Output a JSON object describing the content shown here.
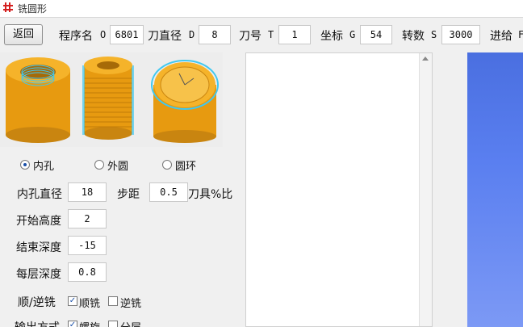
{
  "window": {
    "title": "铣圆形"
  },
  "toolbar": {
    "back_label": "返回",
    "program_label": "程序名",
    "program_prefix": "O",
    "program_value": "6801",
    "diameter_label": "刀直径",
    "diameter_prefix": "D",
    "diameter_value": "8",
    "tool_label": "刀号",
    "tool_prefix": "T",
    "tool_value": "1",
    "coord_label": "坐标",
    "coord_prefix": "G",
    "coord_value": "54",
    "speed_label": "转数",
    "speed_prefix": "S",
    "speed_value": "3000",
    "feed_label": "进给",
    "feed_prefix": "F"
  },
  "modes": [
    {
      "label": "内孔",
      "selected": true
    },
    {
      "label": "外圆",
      "selected": false
    },
    {
      "label": "圆环",
      "selected": false
    }
  ],
  "params": {
    "inner_dia_label": "内孔直径",
    "inner_dia_value": "18",
    "step_label": "步距",
    "step_value": "0.5",
    "tool_pct_label": "刀具%比",
    "start_height_label": "开始高度",
    "start_height_value": "2",
    "end_depth_label": "结束深度",
    "end_depth_value": "-15",
    "layer_depth_label": "每层深度",
    "layer_depth_value": "0.8"
  },
  "milling": {
    "label": "顺/逆铣",
    "climb_label": "顺铣",
    "climb_checked": true,
    "conventional_label": "逆铣",
    "conventional_checked": false
  },
  "output": {
    "label": "输出方式",
    "spiral_label": "螺旋",
    "spiral_checked": true,
    "layered_label": "分层",
    "layered_checked": false
  },
  "colors": {
    "part": "#f0a818",
    "part_dark": "#c98510",
    "toolpath": "#40c8f0",
    "viewport": "#5a7ff0"
  }
}
